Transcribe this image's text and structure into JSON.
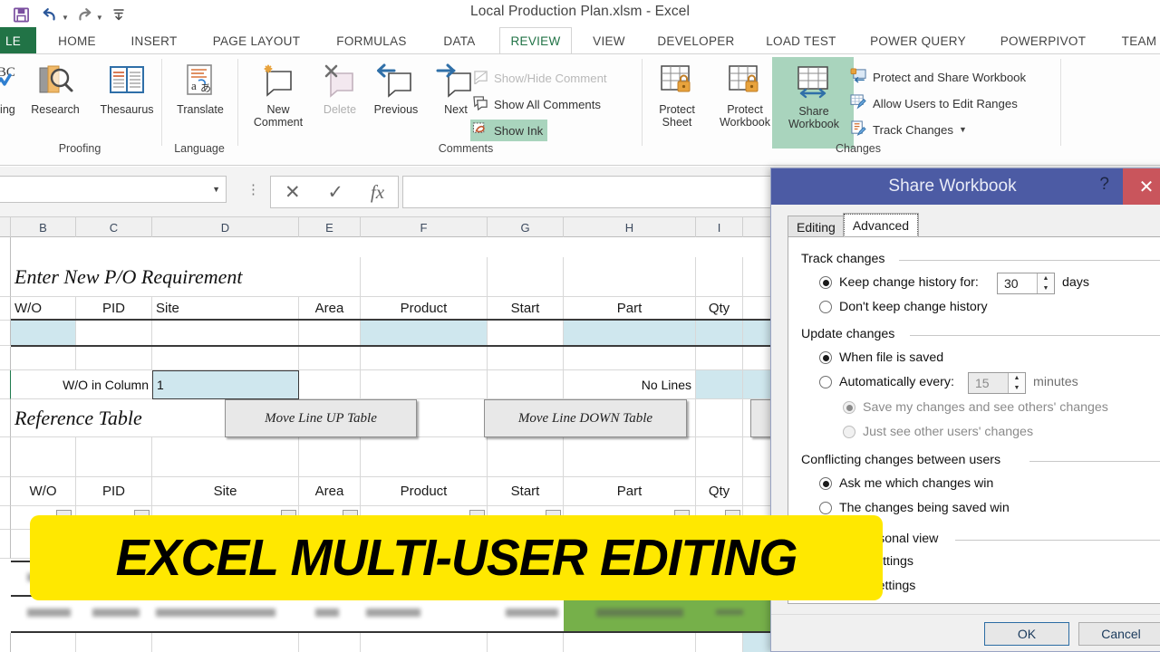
{
  "window": {
    "title": "Local Production Plan.xlsm - Excel",
    "quick_access": [
      {
        "name": "save-icon",
        "glyph": "💾"
      },
      {
        "name": "undo-icon",
        "glyph": "↶"
      },
      {
        "name": "redo-icon",
        "glyph": "↷"
      },
      {
        "name": "customize-qat-icon",
        "glyph": "⩟"
      }
    ]
  },
  "ribbon": {
    "tabs": [
      {
        "label": "LE",
        "id": "file"
      },
      {
        "label": "HOME"
      },
      {
        "label": "INSERT"
      },
      {
        "label": "PAGE LAYOUT"
      },
      {
        "label": "FORMULAS"
      },
      {
        "label": "DATA"
      },
      {
        "label": "REVIEW"
      },
      {
        "label": "VIEW"
      },
      {
        "label": "DEVELOPER"
      },
      {
        "label": "LOAD TEST"
      },
      {
        "label": "POWER QUERY"
      },
      {
        "label": "POWERPIVOT"
      },
      {
        "label": "TEAM"
      }
    ],
    "active_tab": "REVIEW",
    "groups": [
      {
        "label": "Proofing"
      },
      {
        "label": "Language"
      },
      {
        "label": "Comments"
      },
      {
        "label": "Changes"
      }
    ],
    "buttons": {
      "spelling": "ling",
      "research": "Research",
      "thesaurus": "Thesaurus",
      "translate": "Translate",
      "new_comment": "New\nComment",
      "new_comment_l1": "New",
      "new_comment_l2": "Comment",
      "delete": "Delete",
      "previous": "Previous",
      "next": "Next",
      "show_hide_comment": "Show/Hide Comment",
      "show_all_comments": "Show All Comments",
      "show_ink": "Show Ink",
      "protect_sheet_l1": "Protect",
      "protect_sheet_l2": "Sheet",
      "protect_workbook_l1": "Protect",
      "protect_workbook_l2": "Workbook",
      "share_workbook_l1": "Share",
      "share_workbook_l2": "Workbook",
      "protect_and_share": "Protect and Share Workbook",
      "allow_users": "Allow Users to Edit Ranges",
      "track_changes": "Track Changes"
    }
  },
  "formula_bar": {
    "name_box_value": "",
    "formula_value": "",
    "cancel_icon": "✕",
    "enter_icon": "✓",
    "fx_icon": "fx"
  },
  "sheet": {
    "column_headers": [
      "B",
      "C",
      "D",
      "E",
      "F",
      "G",
      "H",
      "I"
    ],
    "section_title_1": "Enter New P/O Requirement",
    "section_title_2": "Reference Table",
    "entry_headers": [
      "W/O",
      "PID",
      "Site",
      "Area",
      "Product",
      "Start",
      "Part",
      "Qty"
    ],
    "wo_in_column_label": "W/O in Column",
    "wo_in_column_value": "1",
    "no_lines_label": "No Lines",
    "buttons": [
      {
        "label": "Move Line UP Table"
      },
      {
        "label": "Move Line DOWN Table"
      }
    ],
    "reference_headers": [
      "W/O",
      "PID",
      "Site",
      "Area",
      "Product",
      "Start",
      "Part",
      "Qty"
    ],
    "filter_icon": "▼"
  },
  "dialog": {
    "title": "Share Workbook",
    "help_icon": "?",
    "close_icon": "✕",
    "tabs": [
      {
        "label": "Editing",
        "selected": false
      },
      {
        "label": "Advanced",
        "selected": true
      }
    ],
    "sections": {
      "track_changes": "Track changes",
      "update_changes": "Update changes",
      "conflicting": "Conflicting changes between users",
      "personal_view": "Include in personal view"
    },
    "options": {
      "keep_history_label": "Keep change history for:",
      "keep_history_days_value": "30",
      "days_unit": "days",
      "dont_keep_history": "Don't keep change history",
      "when_file_saved": "When file is saved",
      "automatically_every": "Automatically every:",
      "automatically_value": "15",
      "minutes_unit": "minutes",
      "save_and_see": "Save my changes and see others' changes",
      "just_see": "Just see other users' changes",
      "ask_me": "Ask me which changes win",
      "changes_saved_win": "The changes being saved win",
      "print_settings": "Print settings",
      "filter_settings": "Filter settings"
    },
    "footer": {
      "ok": "OK",
      "cancel": "Cancel"
    }
  },
  "banner": {
    "text": "EXCEL MULTI-USER EDITING",
    "background": "#ffe800",
    "color": "#000000"
  },
  "colors": {
    "excel_green": "#217346",
    "dialog_blue": "#4c5ba4",
    "close_red": "#c9555c",
    "cell_blue": "#cfe7ee",
    "highlight_green": "#a9d4bd",
    "row_green": "#76b04a"
  }
}
